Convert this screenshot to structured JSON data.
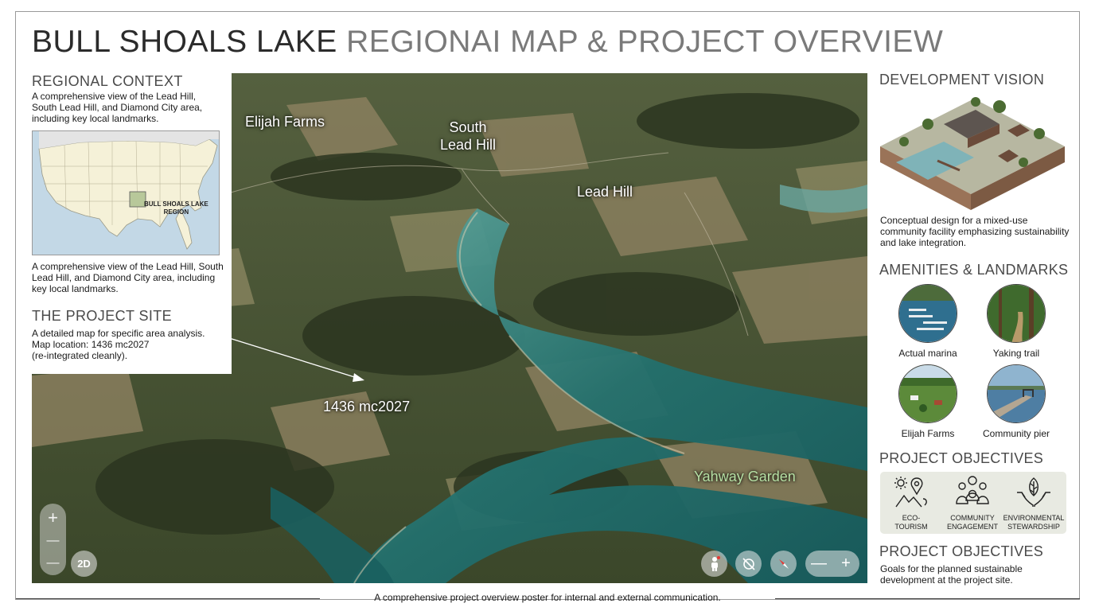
{
  "title": {
    "dark": "BULL SHOALS LAKE",
    "light": "REGIONAI MAP & PROJECT OVERVIEW"
  },
  "left_panel": {
    "regional_heading": "REGIONAL CONTEXT",
    "regional_text": "A comprehensive view of the Lead Hill, South Lead Hill, and Diamond City area, including key local landmarks.",
    "inset_label_line1": "BULL SHOALS LAKE",
    "inset_label_line2": "REGION",
    "inset_caption": "A comprehensive view of the Lead Hill, South Lead Hill, and Diamond City area, including key local landmarks.",
    "site_heading": "THE PROJECT SITE",
    "site_text_line1": "A detailed map for specific area analysis.",
    "site_text_line2": "Map location: 1436 mc2027",
    "site_text_line3": "(re-integrated cleanly)."
  },
  "map_labels": {
    "elijah_farms": "Elijah Farms",
    "south_lead_hill_1": "South",
    "south_lead_hill_2": "Lead Hill",
    "lead_hill": "Lead Hill",
    "site_code": "1436 mc2027",
    "yahway_garden": "Yahway Garden"
  },
  "map_controls": {
    "zoom_in": "+",
    "zoom_mid": "—",
    "zoom_out": "—",
    "mode_2d": "2D",
    "pill_minus": "—",
    "pill_plus": "+"
  },
  "right_panel": {
    "vision_heading": "DEVELOPMENT VISION",
    "vision_text": "Conceptual design for a mixed-use community facility emphasizing sustainability and lake integration.",
    "amenities_heading": "AMENITIES & LANDMARKS",
    "amenities": [
      {
        "label": "Actual marina"
      },
      {
        "label": "Yaking trail"
      },
      {
        "label": "Elijah Farms"
      },
      {
        "label": "Community pier"
      }
    ],
    "objectives_heading": "PROJECT OBJECTIVES",
    "objectives": [
      {
        "line1": "ECO-",
        "line2": "TOURISM",
        "icon": "eco-tourism-icon"
      },
      {
        "line1": "COMMUNITY",
        "line2": "ENGAGEMENT",
        "icon": "community-icon"
      },
      {
        "line1": "ENVIRONMENTAL",
        "line2": "STEWARDSHIP",
        "icon": "stewardship-icon"
      }
    ],
    "objectives_heading_2": "PROJECT OBJECTIVES",
    "objectives_text": "Goals for the planned sustainable development at the project site."
  },
  "footer": "A comprehensive project overview poster for internal and external communication.",
  "colors": {
    "lake": "#1f6b6a",
    "forest": "#3a4627",
    "field": "#8a7f5c"
  }
}
